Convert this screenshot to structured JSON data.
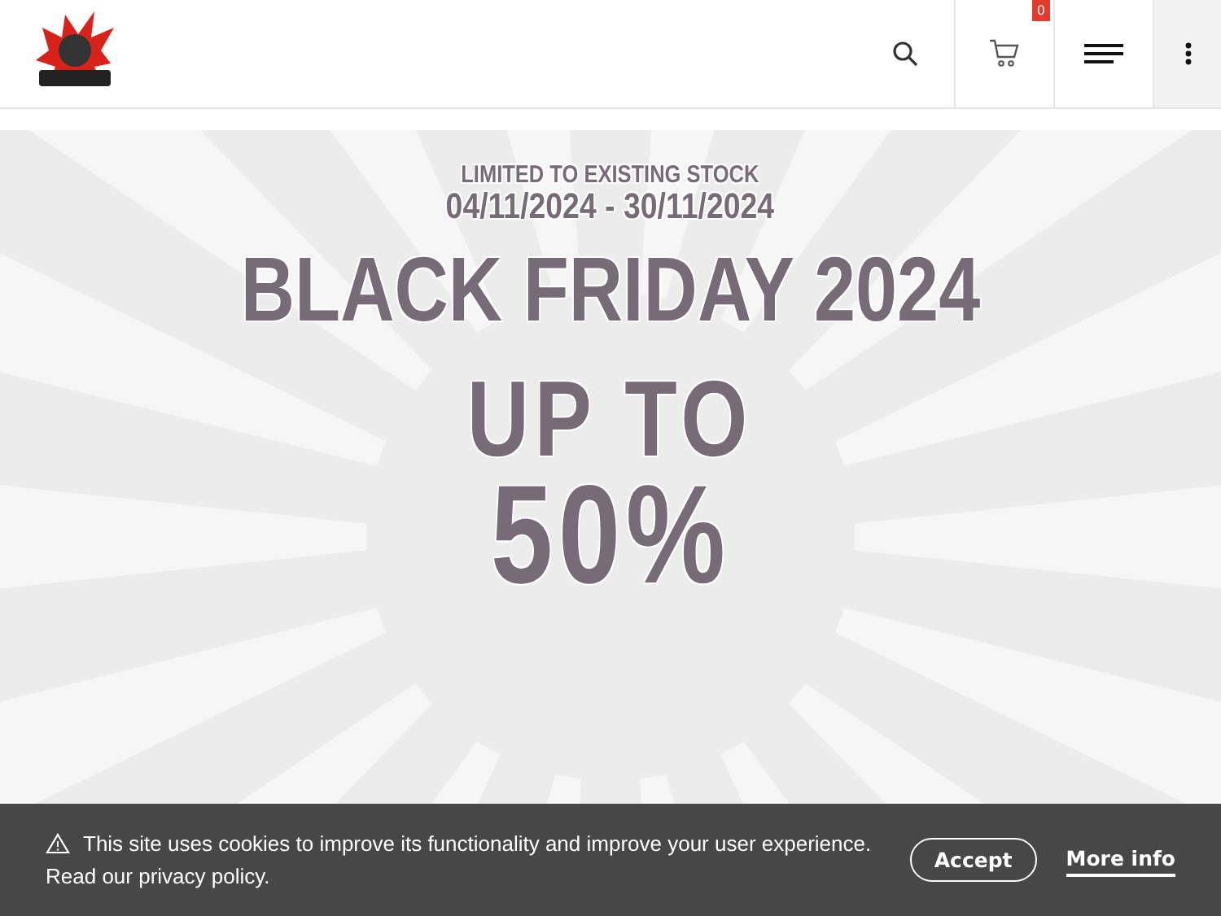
{
  "header": {
    "cart_count": "0"
  },
  "banner": {
    "stock_note": "LIMITED TO EXISTING STOCK",
    "dates": "04/11/2024 - 30/11/2024",
    "headline": "BLACK FRIDAY 2024",
    "offer_lines": [
      "UP TO",
      "50%"
    ]
  },
  "cookie_bar": {
    "message": "This site uses cookies to improve its functionality and improve your user experience. Read our privacy policy.",
    "buttons": [
      {
        "kind": "outline",
        "label": "Accept"
      },
      {
        "kind": "link",
        "label": "More info"
      }
    ]
  }
}
